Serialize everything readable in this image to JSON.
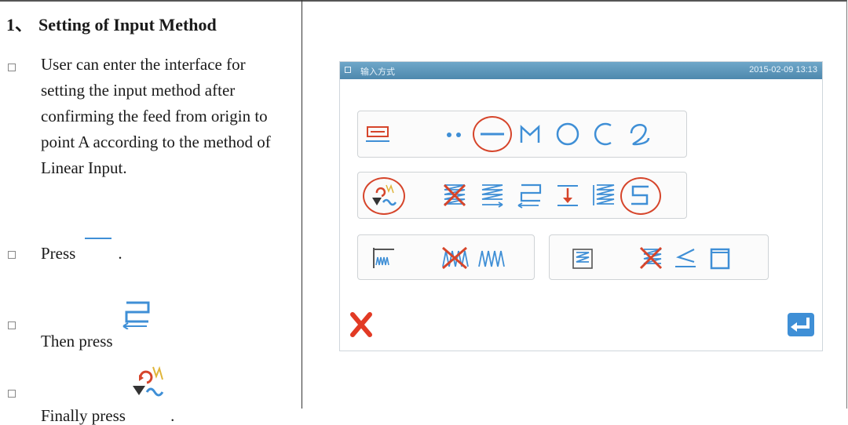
{
  "doc": {
    "heading_number": "1、",
    "heading_title": "Setting of Input Method",
    "bullet_glyph": "□",
    "para": "User can enter the interface for setting the input method after confirming the feed from origin to point A according to the method of Linear Input.",
    "press_label": "Press",
    "press_end": ".",
    "then_label": "Then press",
    "finally_label": "Finally press",
    "finally_end": "."
  },
  "screen": {
    "title": "输入方式",
    "datetime": "2015-02-09 13:13"
  },
  "colors": {
    "accent_blue": "#3f8fd6",
    "highlight_red": "#d6452b",
    "titlebar": "#5a93b8"
  },
  "icons": [
    "feed-point-icon",
    "dots-icon",
    "line-icon",
    "polyline-icon",
    "circle-icon",
    "arc-icon",
    "curve-icon",
    "input-method-icon",
    "zigzag-cross-icon",
    "zigzag-right-icon",
    "back-forth-icon",
    "stitch-down-icon",
    "zigzag-left-icon",
    "s-shape-icon",
    "comb-icon",
    "zigzag-x-icon",
    "zigzag-icon",
    "zigzag-box-icon",
    "cross-left-icon",
    "tri-icon",
    "square-icon",
    "close-icon",
    "enter-icon"
  ]
}
